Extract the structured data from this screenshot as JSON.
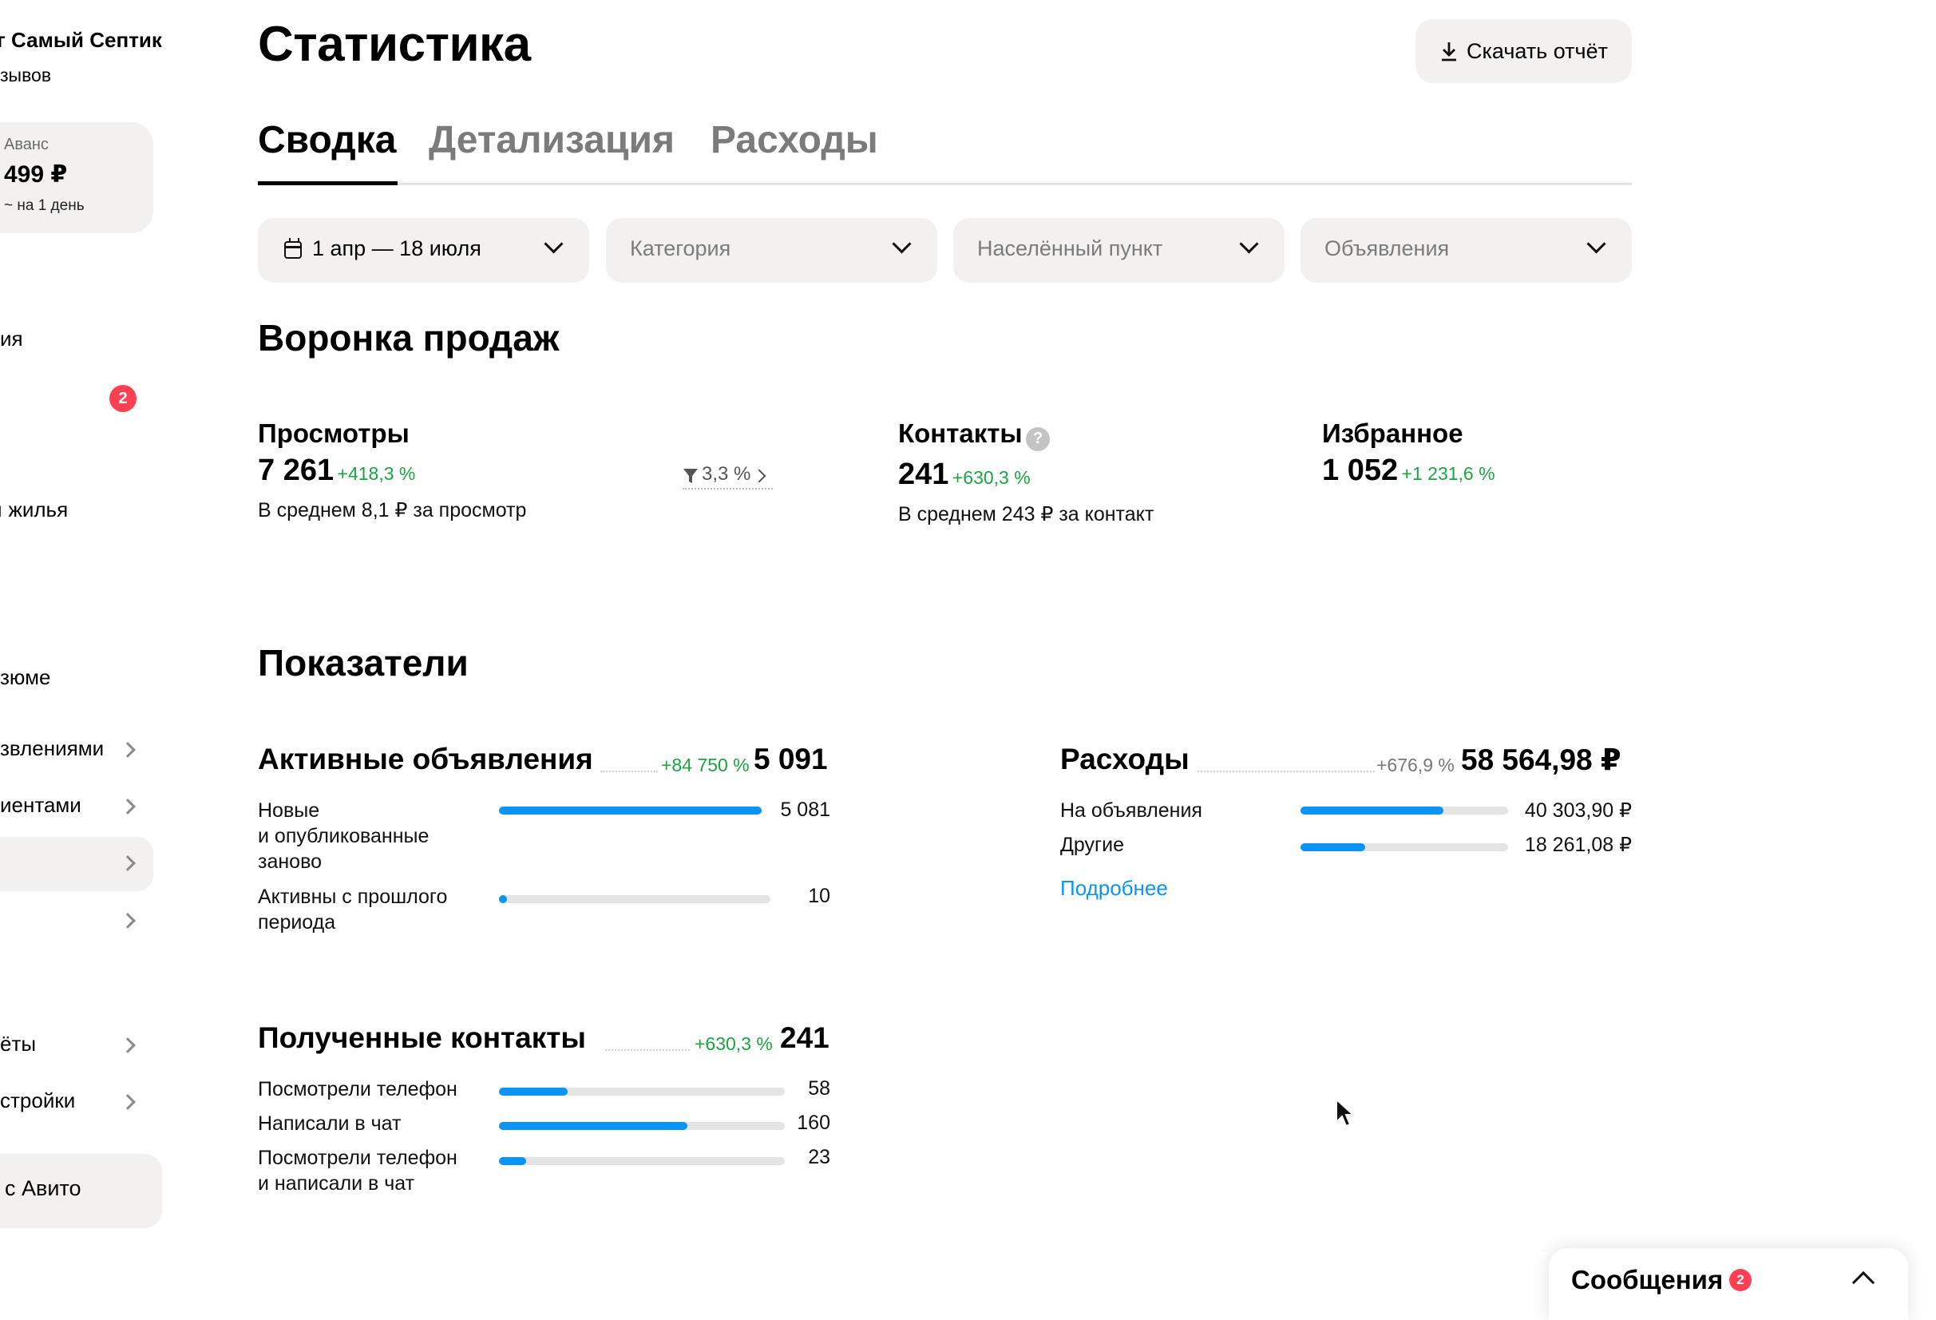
{
  "sidebar": {
    "company": "г Самый Септик",
    "reviews": "зывов",
    "advance": {
      "label": "Аванс",
      "value": "499 ₽",
      "sub": "~ на 1 день"
    },
    "items": [
      {
        "label": "ия"
      },
      {
        "label": "",
        "badge": "2"
      },
      {
        "label": "ı жилья"
      },
      {
        "label": "зюме"
      },
      {
        "label": "звлениями"
      },
      {
        "label": "иентами"
      },
      {
        "label": ""
      },
      {
        "label": ""
      },
      {
        "label": "ёты"
      },
      {
        "label": "стройки"
      }
    ],
    "bottom_button": "с Авито"
  },
  "header": {
    "title": "Статистика",
    "download_button": "Скачать отчёт"
  },
  "tabs": [
    {
      "label": "Сводка",
      "active": true
    },
    {
      "label": "Детализация",
      "active": false
    },
    {
      "label": "Расходы",
      "active": false
    }
  ],
  "filters": {
    "date": "1 апр — 18 июля",
    "category": "Категория",
    "city": "Населённый пункт",
    "ads": "Объявления"
  },
  "funnel": {
    "title": "Воронка продаж",
    "views": {
      "title": "Просмотры",
      "value": "7 261",
      "delta": "+418,3 %",
      "sub": "В среднем 8,1 ₽ за просмотр"
    },
    "conversion": "3,3 %",
    "contacts": {
      "title": "Контакты",
      "value": "241",
      "delta": "+630,3 %",
      "sub": "В среднем 243 ₽ за контакт",
      "help": "?"
    },
    "favorites": {
      "title": "Избранное",
      "value": "1 052",
      "delta": "+1 231,6 %"
    }
  },
  "indicators": {
    "title": "Показатели",
    "active_ads": {
      "title": "Активные объявления",
      "delta": "+84 750 %",
      "total": "5 091",
      "rows": [
        {
          "label": "Новые\nи опубликованные\nзаново",
          "value": "5 081",
          "fraction": 0.998
        },
        {
          "label": "Активны с прошлого\nпериода",
          "value": "10",
          "fraction": 0.03
        }
      ]
    },
    "expenses": {
      "title": "Расходы",
      "delta": "+676,9 %",
      "total": "58 564,98 ₽",
      "rows": [
        {
          "label": "На объявления",
          "value": "40 303,90 ₽",
          "fraction": 0.69
        },
        {
          "label": "Другие",
          "value": "18 261,08 ₽",
          "fraction": 0.31
        }
      ],
      "more_link": "Подробнее"
    },
    "contacts": {
      "title": "Полученные контакты",
      "delta": "+630,3 %",
      "total": "241",
      "rows": [
        {
          "label": "Посмотрели телефон",
          "value": "58",
          "fraction": 0.24
        },
        {
          "label": "Написали в чат",
          "value": "160",
          "fraction": 0.66
        },
        {
          "label": "Посмотрели телефон\nи написали в чат",
          "value": "23",
          "fraction": 0.095
        }
      ]
    }
  },
  "messages": {
    "label": "Сообщения",
    "badge": "2"
  },
  "colors": {
    "accent": "#0a94f5",
    "positive": "#1aa541",
    "badge": "#ff4053",
    "surface": "#f2f1f0"
  }
}
